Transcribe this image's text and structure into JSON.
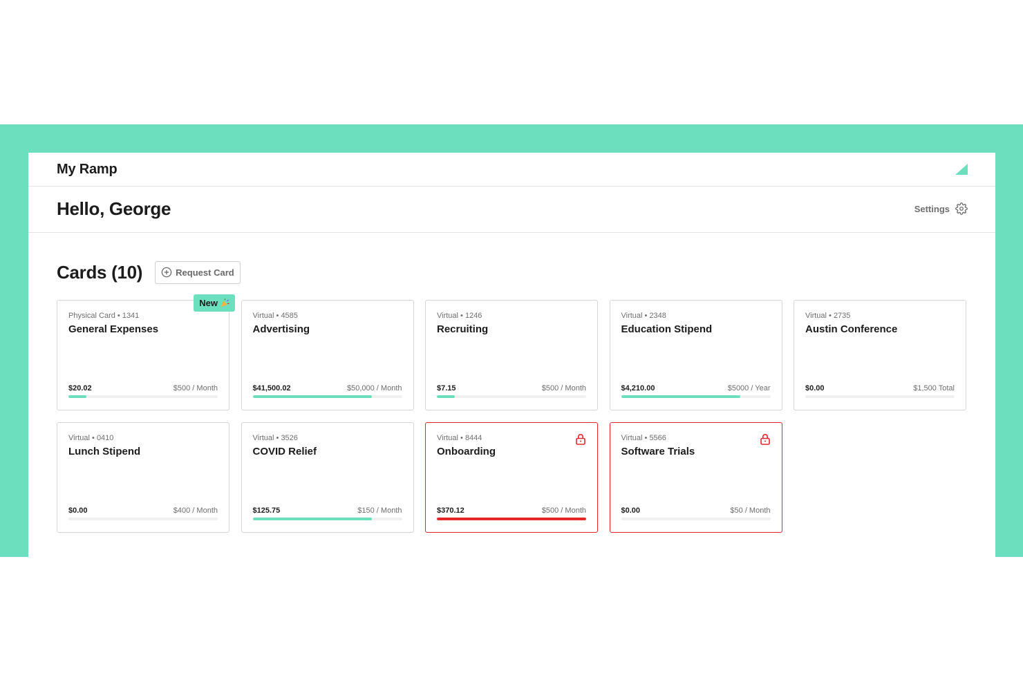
{
  "app": {
    "title": "My Ramp",
    "logo_icon": "ramp-logo-icon",
    "accent_color": "#6ce0be",
    "alert_color": "#e5262a"
  },
  "header": {
    "greeting": "Hello, George",
    "settings_label": "Settings",
    "settings_icon": "gear-icon"
  },
  "cards_section": {
    "title": "Cards (10)",
    "request_button_label": "Request Card",
    "request_button_icon": "plus-circle-icon"
  },
  "cards": [
    {
      "type": "Physical Card",
      "last4": "1341",
      "meta": "Physical Card • 1341",
      "name": "General Expenses",
      "spent": "$20.02",
      "limit": "$500 / Month",
      "progress": 0.12,
      "badge": "New",
      "badge_icon": "party-popper-icon",
      "locked": false
    },
    {
      "type": "Virtual",
      "last4": "4585",
      "meta": "Virtual • 4585",
      "name": "Advertising",
      "spent": "$41,500.02",
      "limit": "$50,000 / Month",
      "progress": 0.8,
      "locked": false
    },
    {
      "type": "Virtual",
      "last4": "1246",
      "meta": "Virtual • 1246",
      "name": "Recruiting",
      "spent": "$7.15",
      "limit": "$500 / Month",
      "progress": 0.12,
      "locked": false
    },
    {
      "type": "Virtual",
      "last4": "2348",
      "meta": "Virtual • 2348",
      "name": "Education Stipend",
      "spent": "$4,210.00",
      "limit": "$5000 / Year",
      "progress": 0.8,
      "locked": false
    },
    {
      "type": "Virtual",
      "last4": "2735",
      "meta": "Virtual • 2735",
      "name": "Austin Conference",
      "spent": "$0.00",
      "limit": "$1,500 Total",
      "progress": 0,
      "locked": false
    },
    {
      "type": "Virtual",
      "last4": "0410",
      "meta": "Virtual • 0410",
      "name": "Lunch Stipend",
      "spent": "$0.00",
      "limit": "$400 / Month",
      "progress": 0,
      "locked": false
    },
    {
      "type": "Virtual",
      "last4": "3526",
      "meta": "Virtual • 3526",
      "name": "COVID Relief",
      "spent": "$125.75",
      "limit": "$150 / Month",
      "progress": 0.8,
      "locked": false
    },
    {
      "type": "Virtual",
      "last4": "8444",
      "meta": "Virtual • 8444",
      "name": "Onboarding",
      "spent": "$370.12",
      "limit": "$500 / Month",
      "progress": 1,
      "locked": true,
      "lock_icon": "lock-icon"
    },
    {
      "type": "Virtual",
      "last4": "5566",
      "meta": "Virtual • 5566",
      "name": "Software Trials",
      "spent": "$0.00",
      "limit": "$50 / Month",
      "progress": 0,
      "locked": true,
      "lock_icon": "lock-icon"
    }
  ]
}
